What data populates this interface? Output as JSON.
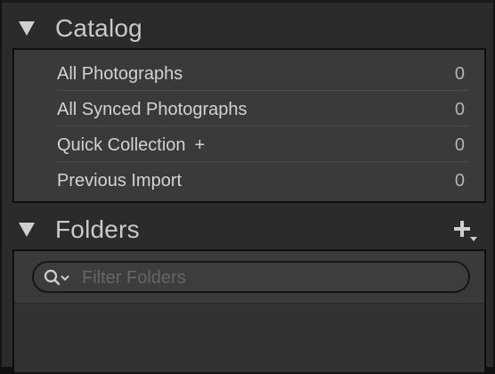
{
  "catalog": {
    "title": "Catalog",
    "items": [
      {
        "label": "All Photographs",
        "count": "0"
      },
      {
        "label": "All Synced Photographs",
        "count": "0"
      },
      {
        "label": "Quick Collection",
        "suffix": "+",
        "count": "0"
      },
      {
        "label": "Previous Import",
        "count": "0"
      }
    ]
  },
  "folders": {
    "title": "Folders",
    "add_icon": "plus-dropdown-icon",
    "filter": {
      "placeholder": "Filter Folders",
      "value": "",
      "icon": "search-dropdown-icon"
    }
  },
  "colors": {
    "panel_bg": "#2b2b2b",
    "box_bg": "#3a3a3a",
    "text": "#d2d2d2",
    "header_text": "#c9c9c9"
  }
}
